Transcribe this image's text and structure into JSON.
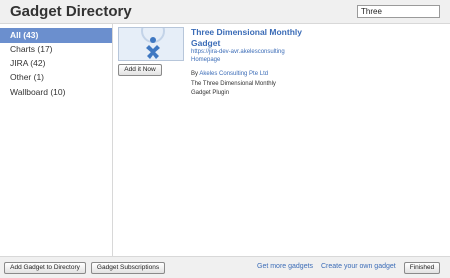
{
  "header": {
    "title": "Gadget Directory",
    "search_value": "Three"
  },
  "sidebar": {
    "categories": [
      {
        "label": "All (43)",
        "active": true
      },
      {
        "label": "Charts (17)",
        "active": false
      },
      {
        "label": "JIRA (42)",
        "active": false
      },
      {
        "label": "Other (1)",
        "active": false
      },
      {
        "label": "Wallboard (10)",
        "active": false
      }
    ]
  },
  "gadget": {
    "title": "Three Dimensional Monthly Gadget",
    "url": "https://jira-dev-avr.akelesconsulting",
    "homepage": "Homepage",
    "by_label": "By",
    "author": "Akeles Consulting Pte Ltd",
    "description": "The Three Dimensional Monthly Gadget Plugin",
    "add_label": "Add it Now"
  },
  "footer": {
    "add_to_directory": "Add Gadget to Directory",
    "subscriptions": "Gadget Subscriptions",
    "get_more": "Get more gadgets",
    "create_own": "Create your own gadget",
    "finished": "Finished"
  },
  "colors": {
    "accent": "#6b8fce",
    "link": "#3b6cb7",
    "chrome": "#f0f0f0"
  }
}
